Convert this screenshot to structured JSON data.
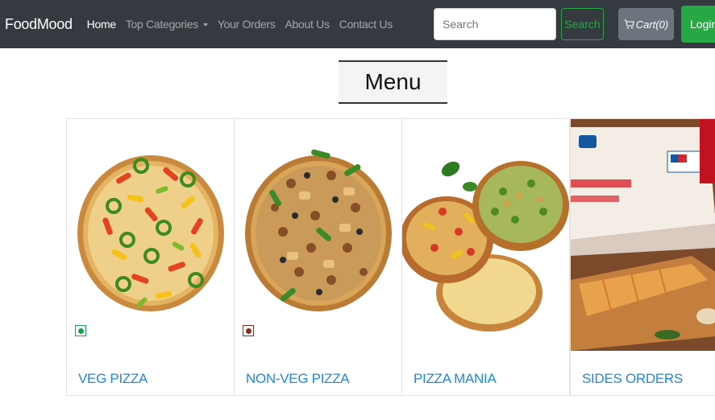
{
  "navbar": {
    "brand": "FoodMood",
    "links": [
      {
        "label": "Home",
        "active": true
      },
      {
        "label": "Top Categories",
        "dropdown": true
      },
      {
        "label": "Your Orders"
      },
      {
        "label": "About Us"
      },
      {
        "label": "Contact Us"
      }
    ],
    "search_placeholder": "Search",
    "search_button": "Search",
    "cart_label": "Cart(0)",
    "login_label": "Login"
  },
  "page_title": "Menu",
  "categories": [
    {
      "title": "VEG PIZZA",
      "diet": "veg",
      "image": "veg-pizza"
    },
    {
      "title": "NON-VEG PIZZA",
      "diet": "non-veg",
      "image": "non-veg-pizza"
    },
    {
      "title": "PIZZA MANIA",
      "image": "pizza-mania"
    },
    {
      "title": "SIDES ORDERS",
      "image": "sides-orders"
    }
  ],
  "colors": {
    "navbar": "#343a40",
    "success": "#28a745",
    "secondary": "#6c757d",
    "link": "#1e88e5",
    "veg": "#17a24a",
    "non_veg": "#8b2a1a"
  }
}
